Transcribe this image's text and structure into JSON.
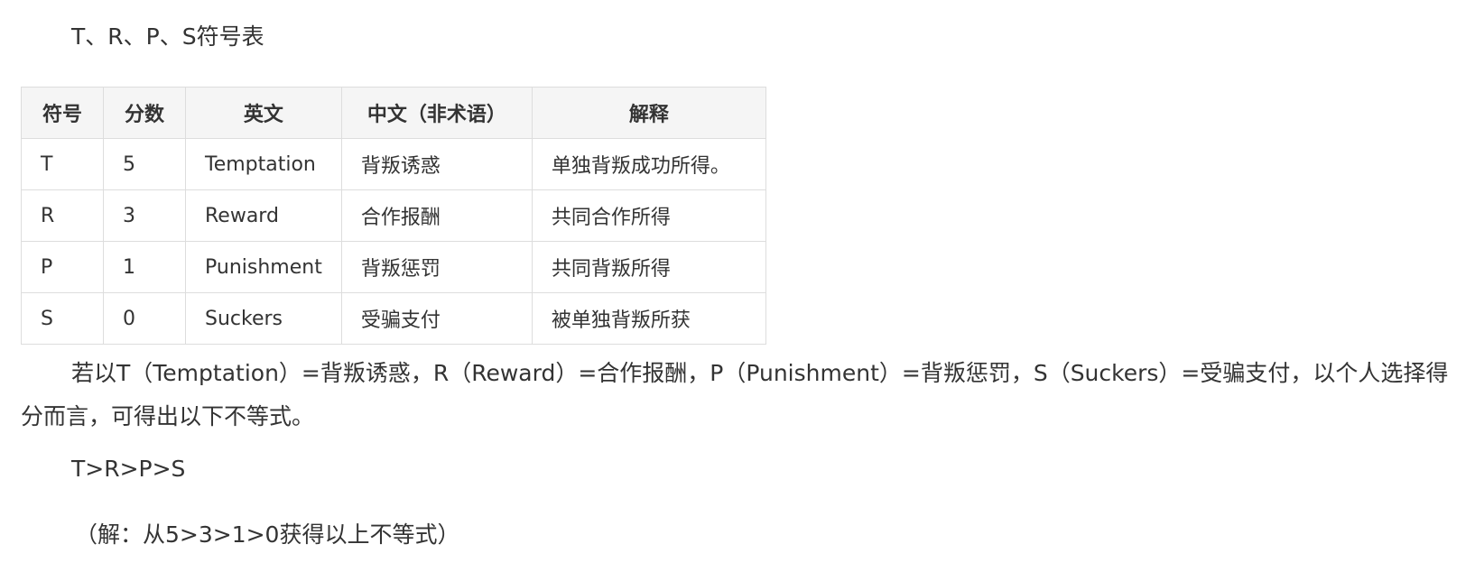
{
  "title": "T、R、P、S符号表",
  "table": {
    "headers": [
      "符号",
      "分数",
      "英文",
      "中文（非术语）",
      "解释"
    ],
    "rows": [
      [
        "T",
        "5",
        "Temptation",
        "背叛诱惑",
        "单独背叛成功所得。"
      ],
      [
        "R",
        "3",
        "Reward",
        "合作报酬",
        "共同合作所得"
      ],
      [
        "P",
        "1",
        "Punishment",
        "背叛惩罚",
        "共同背叛所得"
      ],
      [
        "S",
        "0",
        "Suckers",
        "受骗支付",
        "被单独背叛所获"
      ]
    ]
  },
  "description": "若以T（Temptation）=背叛诱惑，R（Reward）=合作报酬，P（Punishment）=背叛惩罚，S（Suckers）=受骗支付，以个人选择得分而言，可得出以下不等式。",
  "inequality": "T>R>P>S",
  "note": "（解：从5>3>1>0获得以上不等式）"
}
